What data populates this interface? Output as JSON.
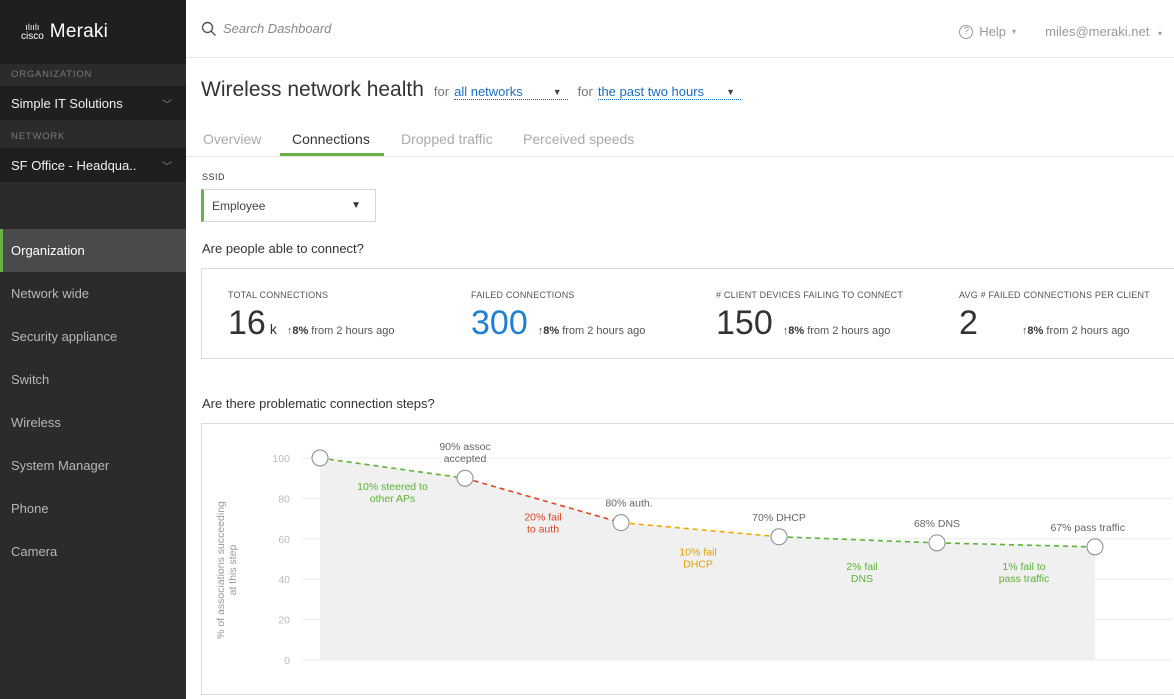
{
  "brand": {
    "cisco": "cisco",
    "meraki": "Meraki"
  },
  "sidebar": {
    "org_label": "ORGANIZATION",
    "org_value": "Simple IT Solutions",
    "net_label": "NETWORK",
    "net_value": "SF Office - Headqua..",
    "items": [
      {
        "label": "Organization",
        "active": true
      },
      {
        "label": "Network wide"
      },
      {
        "label": "Security appliance"
      },
      {
        "label": "Switch"
      },
      {
        "label": "Wireless"
      },
      {
        "label": "System Manager"
      },
      {
        "label": "Phone"
      },
      {
        "label": "Camera"
      }
    ]
  },
  "topbar": {
    "search_placeholder": "Search Dashboard",
    "help": "Help",
    "user": "miles@meraki.net"
  },
  "page": {
    "title": "Wireless network health",
    "for1": "for",
    "networks": "all networks",
    "for2": "for",
    "timerange": "the past two hours"
  },
  "tabs": [
    "Overview",
    "Connections",
    "Dropped traffic",
    "Perceived speeds"
  ],
  "active_tab": "Connections",
  "ssid": {
    "label": "SSID",
    "value": "Employee"
  },
  "q1": "Are people able to connect?",
  "q2": "Are there problematic connection steps?",
  "stats": [
    {
      "label": "TOTAL CONNECTIONS",
      "value": "16",
      "unit": "k",
      "delta_pct": "8%",
      "delta_text": "from 2 hours ago"
    },
    {
      "label": "FAILED CONNECTIONS",
      "value": "300",
      "unit": "",
      "delta_pct": "8%",
      "delta_text": "from 2 hours ago"
    },
    {
      "label": "# CLIENT DEVICES FAILING TO CONNECT",
      "value": "150",
      "unit": "",
      "delta_pct": "8%",
      "delta_text": "from 2 hours ago"
    },
    {
      "label": "AVG # FAILED CONNECTIONS PER CLIENT",
      "value": "2",
      "unit": "",
      "delta_pct": "8%",
      "delta_text": "from 2 hours ago"
    }
  ],
  "colors": {
    "accent": "#67b346",
    "green": "#5cb335",
    "red": "#e0431f",
    "orange": "#f0a800",
    "blue": "#1f7fd1"
  },
  "chart_data": {
    "type": "line",
    "ylabel": "% of associations succeeding at this step",
    "ylim": [
      0,
      100
    ],
    "yticks": [
      0,
      20,
      40,
      60,
      80,
      100
    ],
    "points": [
      {
        "label": "",
        "value": 100
      },
      {
        "label": "90% assoc accepted",
        "value": 90
      },
      {
        "label": "80% auth.",
        "value": 68
      },
      {
        "label": "70% DHCP",
        "value": 61
      },
      {
        "label": "68% DNS",
        "value": 58
      },
      {
        "label": "67% pass traffic",
        "value": 56
      }
    ],
    "segments": [
      {
        "label": "10% steered to other APs",
        "color": "green"
      },
      {
        "label": "20% fail to auth",
        "color": "red"
      },
      {
        "label": "10% fail DHCP",
        "color": "orange"
      },
      {
        "label": "2% fail DNS",
        "color": "green"
      },
      {
        "label": "1% fail to pass traffic",
        "color": "green"
      }
    ]
  }
}
